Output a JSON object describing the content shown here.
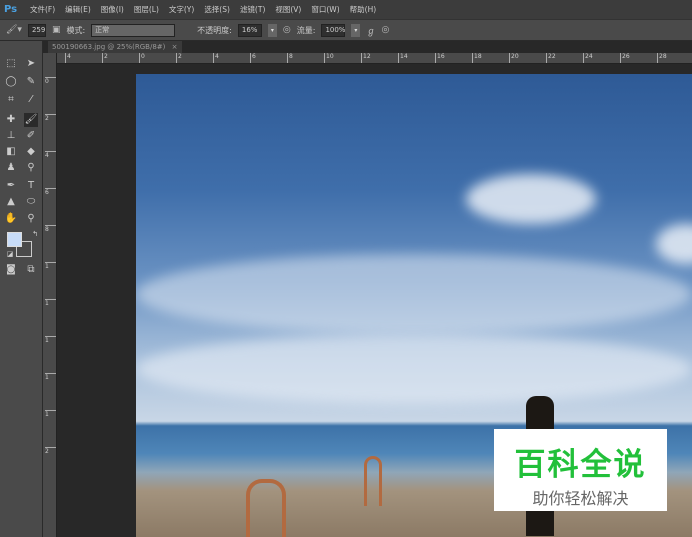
{
  "app": {
    "logo": "Ps"
  },
  "menu": [
    "文件(F)",
    "编辑(E)",
    "图像(I)",
    "图层(L)",
    "文字(Y)",
    "选择(S)",
    "滤镜(T)",
    "视图(V)",
    "窗口(W)",
    "帮助(H)"
  ],
  "options": {
    "brush_size": "259",
    "mode_label": "模式:",
    "mode_value": "正常",
    "opacity_label": "不透明度:",
    "opacity_value": "16%",
    "flow_label": "流量:",
    "flow_value": "100%"
  },
  "document": {
    "tab_title": "500190663.jpg @ 25%(RGB/8#)",
    "close": "×"
  },
  "ruler": {
    "h": [
      "4",
      "2",
      "0",
      "2",
      "4",
      "6",
      "8",
      "10",
      "12",
      "14",
      "16",
      "18",
      "20",
      "22",
      "24",
      "26",
      "28"
    ],
    "v": [
      "0",
      "2",
      "4",
      "6",
      "8",
      "1",
      "1",
      "1",
      "1",
      "1",
      "2"
    ]
  },
  "watermark": {
    "title": "百科全说",
    "subtitle": "助你轻松解决"
  },
  "colors": {
    "foreground": "#c8dcf8",
    "background": "#ffffff"
  }
}
